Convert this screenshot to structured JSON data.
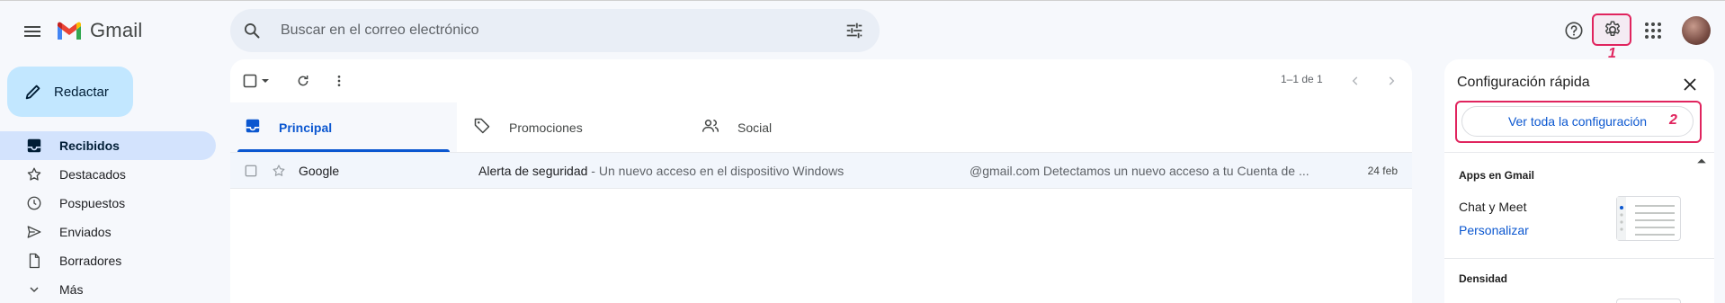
{
  "app": {
    "name": "Gmail"
  },
  "search": {
    "placeholder": "Buscar en el correo electrónico"
  },
  "compose": {
    "label": "Redactar"
  },
  "nav": {
    "items": [
      {
        "label": "Recibidos",
        "icon": "inbox-icon",
        "active": true
      },
      {
        "label": "Destacados",
        "icon": "star-icon"
      },
      {
        "label": "Pospuestos",
        "icon": "clock-icon"
      },
      {
        "label": "Enviados",
        "icon": "send-icon"
      },
      {
        "label": "Borradores",
        "icon": "draft-icon"
      },
      {
        "label": "Más",
        "icon": "chevron-down-icon"
      }
    ]
  },
  "toolbar": {
    "pagination": "1–1 de 1"
  },
  "tabs": [
    {
      "label": "Principal",
      "icon": "inbox-icon",
      "active": true
    },
    {
      "label": "Promociones",
      "icon": "tag-icon"
    },
    {
      "label": "Social",
      "icon": "people-icon"
    }
  ],
  "emails": [
    {
      "sender": "Google",
      "subject": "Alerta de seguridad",
      "snippet": " - Un nuevo acceso en el dispositivo Windows",
      "preview": "@gmail.com Detectamos un nuevo acceso a tu Cuenta de ...",
      "date": "24 feb"
    }
  ],
  "annotations": {
    "first": "1",
    "second": "2"
  },
  "quick_settings": {
    "title": "Configuración rápida",
    "all_settings": "Ver toda la configuración",
    "apps_title": "Apps en Gmail",
    "chat_meet": "Chat y Meet",
    "customize": "Personalizar",
    "density_title": "Densidad"
  },
  "colors": {
    "accent": "#0b57d0",
    "highlight": "#e0245e",
    "compose_bg": "#c2e7ff",
    "active_nav_bg": "#d3e3fd"
  }
}
